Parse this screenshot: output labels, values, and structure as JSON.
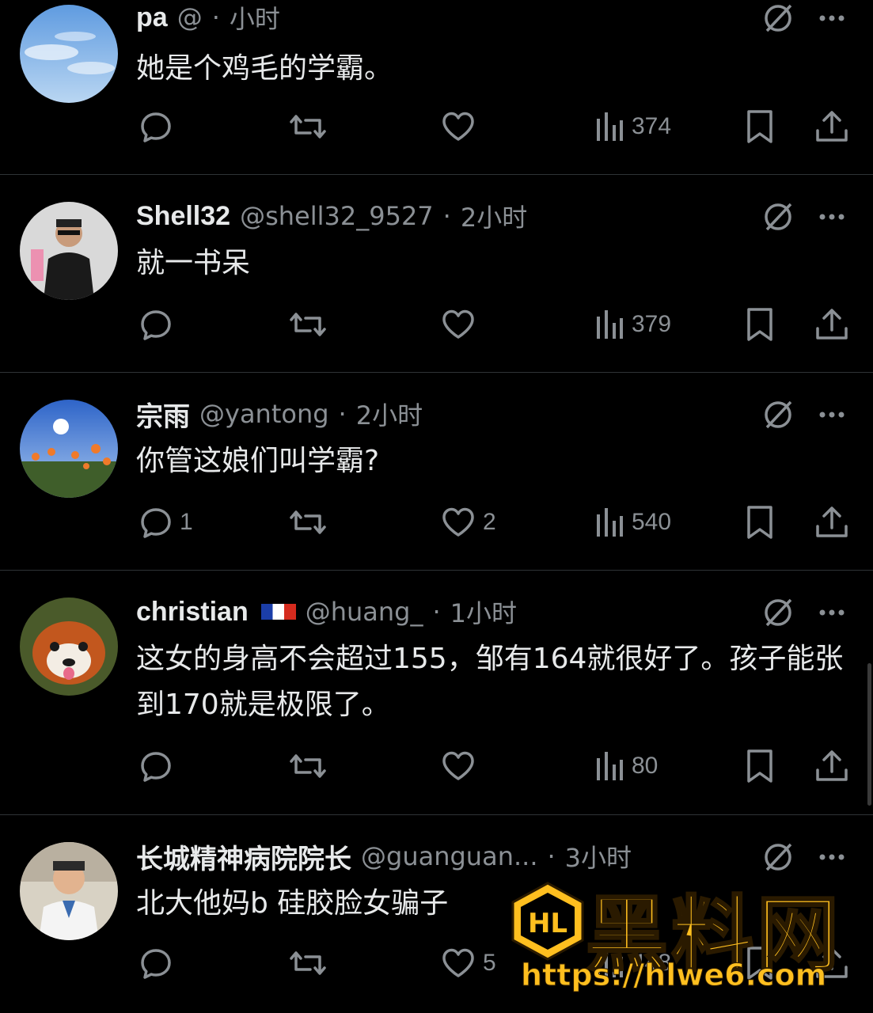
{
  "posts": [
    {
      "name": "pa",
      "handle": "@",
      "time": "小时",
      "text": "她是个鸡毛的学霸。",
      "counts": {
        "reply": "",
        "repost": "",
        "like": "",
        "views": "374"
      }
    },
    {
      "name": "Shell32",
      "handle": "@shell32_9527",
      "time": "2小时",
      "text": "就一书呆",
      "counts": {
        "reply": "",
        "repost": "",
        "like": "",
        "views": "379"
      }
    },
    {
      "name": "宗雨",
      "handle": "@yantong",
      "time": "2小时",
      "text": "你管这娘们叫学霸?",
      "counts": {
        "reply": "1",
        "repost": "",
        "like": "2",
        "views": "540"
      }
    },
    {
      "name": "christian",
      "handle": "@huang_",
      "time": "1小时",
      "text": "这女的身高不会超过155，邹有164就很好了。孩子能张到170就是极限了。",
      "counts": {
        "reply": "",
        "repost": "",
        "like": "",
        "views": "80"
      }
    },
    {
      "name": "长城精神病院院长",
      "handle": "@guanguan...",
      "time": "3小时",
      "text": "北大他妈b 硅胶脸女骗子",
      "counts": {
        "reply": "",
        "repost": "",
        "like": "5",
        "views": "448"
      }
    }
  ],
  "separator": "·",
  "watermark": {
    "logo_text": "HL",
    "brand": "黑料网",
    "url": "https://hlwe6.com"
  },
  "colors": {
    "background": "#000000",
    "text": "#e7e9ea",
    "muted": "#8b9095",
    "divider": "#2f3336",
    "watermark": "#ffbf1f"
  }
}
